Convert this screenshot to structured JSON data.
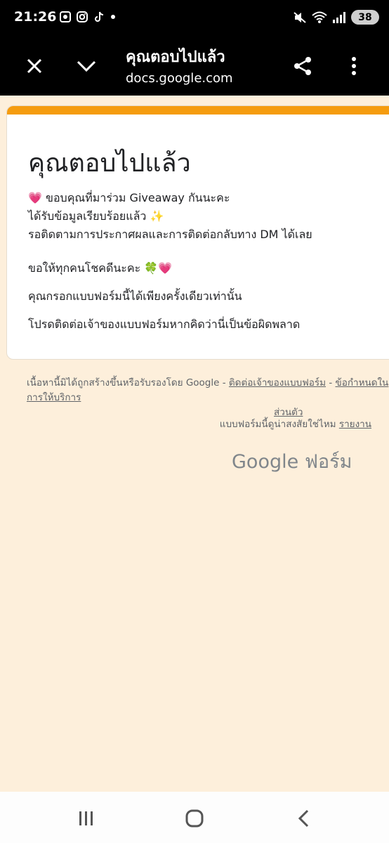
{
  "status_bar": {
    "time": "21:26",
    "battery": "38"
  },
  "app_bar": {
    "title": "คุณตอบไปแล้ว",
    "url": "docs.google.com"
  },
  "card": {
    "title": "คุณตอบไปแล้ว",
    "lines": [
      "💗 ขอบคุณที่มาร่วม Giveaway กันนะคะ",
      "ได้รับข้อมูลเรียบร้อยแล้ว ✨",
      "รอติดตามการประกาศผลและการติดต่อกลับทาง DM ได้เลย"
    ],
    "luck_line": "ขอให้ทุกคนโชคดีนะคะ 🍀💗",
    "once_note": "คุณกรอกแบบฟอร์มนี้ได้เพียงครั้งเดียวเท่านั้น",
    "contact_note": "โปรดติดต่อเจ้าของแบบฟอร์มหากคิดว่านี่เป็นข้อผิดพลาด"
  },
  "footer": {
    "disclaimer": "เนื้อหานี้มิได้ถูกสร้างขึ้นหรือรับรองโดย Google -",
    "contact_owner_link": "ติดต่อเจ้าของแบบฟอร์ม",
    "separator": "-",
    "privacy_link": "ข้อกำหนดในการให้บริการ",
    "privacy_link_cont": "ส่วนตัว",
    "suspicious_text": "แบบฟอร์มนี้ดูน่าสงสัยใช่ไหม",
    "report_link": "รายงาน",
    "logo_google": "Google",
    "logo_forms": "ฟอร์ม"
  },
  "colors": {
    "accent": "#f59c0f",
    "background": "#fdefdb"
  }
}
